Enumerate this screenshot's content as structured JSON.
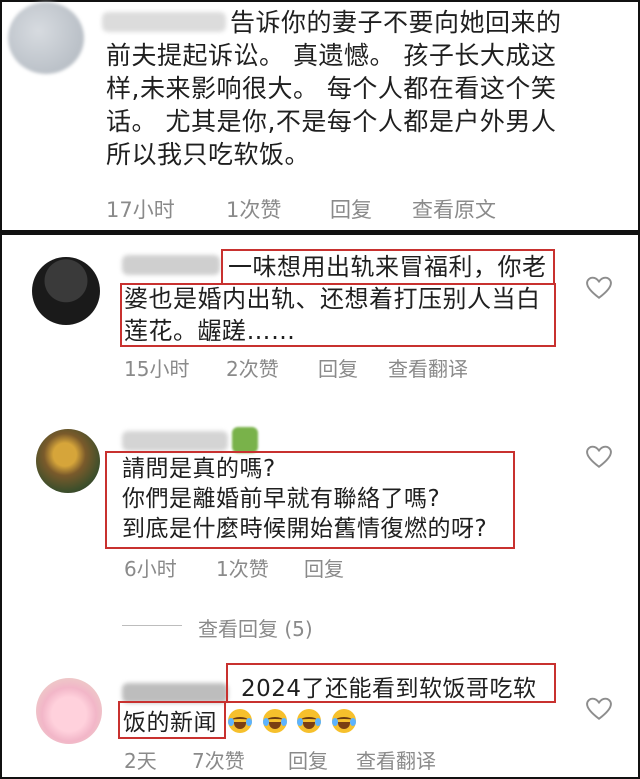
{
  "top_comment": {
    "lines": [
      "告诉你的妻子不要向她回来的",
      "前夫提起诉讼。 真遗憾。 孩子长大成这",
      "样,未来影响很大。 每个人都在看这个笑",
      "话。 尤其是你,不是每个人都是户外男人",
      "所以我只吃软饭。"
    ],
    "time": "17小时",
    "likes": "1次赞",
    "reply": "回复",
    "view_original": "查看原文"
  },
  "comments": [
    {
      "lines": [
        "一味想用出轨来冒福利，你老",
        "婆也是婚内出轨、还想着打压别人当白",
        "莲花。龌蹉……"
      ],
      "time": "15小时",
      "likes": "2次赞",
      "reply": "回复",
      "translate": "查看翻译"
    },
    {
      "lines": [
        "請問是真的嗎?",
        "你們是離婚前早就有聯絡了嗎?",
        "到底是什麼時候開始舊情復燃的呀?"
      ],
      "time": "6小时",
      "likes": "1次赞",
      "reply": "回复",
      "view_replies": "查看回复 (5)"
    },
    {
      "lines": [
        "2024了还能看到软饭哥吃软",
        "饭的新闻"
      ],
      "time": "2天",
      "likes": "7次赞",
      "reply": "回复",
      "translate": "查看翻译"
    }
  ],
  "colors": {
    "highlight_box": "#c8312f",
    "meta_text": "#8a8a8a",
    "border": "#111111"
  },
  "icons": [
    "heart-icon",
    "face-with-tears-of-joy-emoji"
  ]
}
